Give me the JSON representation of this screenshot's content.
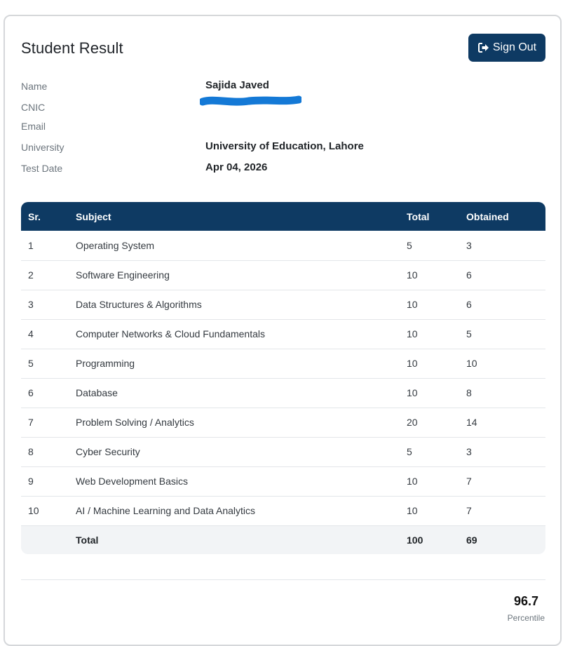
{
  "header": {
    "title": "Student Result",
    "signout_label": "Sign Out",
    "signout_icon": "sign-out-icon"
  },
  "student": {
    "name_label": "Name",
    "name": "Sajida Javed",
    "cnic_label": "CNIC",
    "email_label": "Email",
    "university_label": "University",
    "university": "University of Education, Lahore",
    "test_date_label": "Test Date",
    "test_date": "Apr 04, 2026"
  },
  "table": {
    "headers": {
      "sr": "Sr.",
      "subject": "Subject",
      "total": "Total",
      "obtained": "Obtained"
    },
    "rows": [
      {
        "sr": "1",
        "subject": "Operating System",
        "total": "5",
        "obtained": "3"
      },
      {
        "sr": "2",
        "subject": "Software Engineering",
        "total": "10",
        "obtained": "6"
      },
      {
        "sr": "3",
        "subject": "Data Structures & Algorithms",
        "total": "10",
        "obtained": "6"
      },
      {
        "sr": "4",
        "subject": "Computer Networks & Cloud Fundamentals",
        "total": "10",
        "obtained": "5"
      },
      {
        "sr": "5",
        "subject": "Programming",
        "total": "10",
        "obtained": "10"
      },
      {
        "sr": "6",
        "subject": "Database",
        "total": "10",
        "obtained": "8"
      },
      {
        "sr": "7",
        "subject": "Problem Solving / Analytics",
        "total": "20",
        "obtained": "14"
      },
      {
        "sr": "8",
        "subject": "Cyber Security",
        "total": "5",
        "obtained": "3"
      },
      {
        "sr": "9",
        "subject": "Web Development Basics",
        "total": "10",
        "obtained": "7"
      },
      {
        "sr": "10",
        "subject": "AI / Machine Learning and Data Analytics",
        "total": "10",
        "obtained": "7"
      }
    ],
    "footer": {
      "label": "Total",
      "total": "100",
      "obtained": "69"
    }
  },
  "summary": {
    "percentile_value": "96.7",
    "percentile_label": "Percentile"
  },
  "colors": {
    "primary": "#0e3a63",
    "redaction": "#1479d6"
  }
}
